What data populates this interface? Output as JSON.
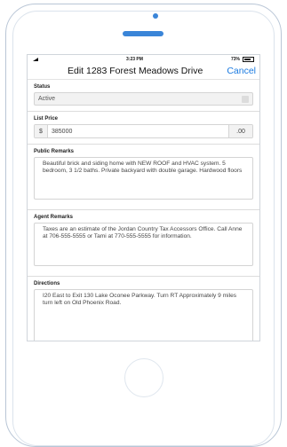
{
  "status_bar": {
    "time": "3:23 PM",
    "battery": "73%"
  },
  "nav": {
    "title": "Edit 1283 Forest Meadows Drive",
    "cancel_label": "Cancel"
  },
  "form": {
    "status": {
      "label": "Status",
      "value": "Active"
    },
    "list_price": {
      "label": "List Price",
      "prefix": "$",
      "value": "385000",
      "suffix": ".00"
    },
    "public_remarks": {
      "label": "Public Remarks",
      "value": "Beautiful brick and siding home with NEW ROOF and HVAC system. 5 bedroom, 3 1/2 baths. Private backyard with double garage. Hardwood floors"
    },
    "agent_remarks": {
      "label": "Agent Remarks",
      "value": "Taxes are an estimate of the Jordan Country Tax Accessors Office. Call Anne at 706-555-5555 or Tami at 770-555-5555 for information."
    },
    "directions": {
      "label": "Directions",
      "value": "I20 East to Exit 130 Lake Oconee Parkway. Turn RT Approximately 9 miles turn left on Old Phoenix Road."
    }
  },
  "colors": {
    "accent": "#1a7ae0",
    "phone_outline": "#b9c6d6",
    "camera": "#3a85d8"
  },
  "icons": [
    "camera-icon",
    "speaker-icon",
    "signal-icon",
    "battery-icon",
    "chevron-down-icon"
  ]
}
